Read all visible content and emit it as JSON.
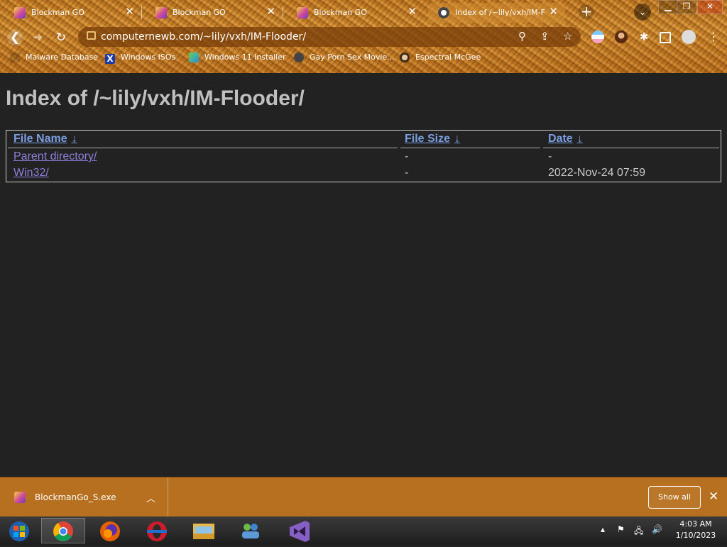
{
  "browser": {
    "tabs": [
      {
        "title": "Blockman GO",
        "active": false
      },
      {
        "title": "Blockman GO",
        "active": false
      },
      {
        "title": "Blockman GO",
        "active": false
      },
      {
        "title": "Index of /~lily/vxh/IM-F",
        "active": true
      }
    ],
    "tab_close": "✕",
    "new_tab": "+",
    "tab_search_icon": "chevron-down-icon",
    "window_controls": {
      "minimize": "▁",
      "restore": "❐",
      "close": "✕"
    },
    "address": "computernewb.com/~lily/vxh/IM-Flooder/",
    "nav": {
      "back": "❮",
      "forward": "➜",
      "reload": "↻"
    }
  },
  "bookmarks": [
    {
      "label": "Malware Database",
      "icon": "folder-icon"
    },
    {
      "label": "Windows ISOs",
      "icon": "x-logo-icon"
    },
    {
      "label": "Windows 11 Installer",
      "icon": "installer-icon"
    },
    {
      "label": "Gay Porn Sex Movie...",
      "icon": "site-icon"
    },
    {
      "label": "Espectral McGee",
      "icon": "face-icon"
    }
  ],
  "page": {
    "heading": "Index of /~lily/vxh/IM-Flooder/",
    "columns": [
      {
        "label": "File Name",
        "sort": "↓"
      },
      {
        "label": "File Size",
        "sort": "↓"
      },
      {
        "label": "Date",
        "sort": "↓"
      }
    ],
    "rows": [
      {
        "name": "Parent directory/",
        "size": "-",
        "date": "-"
      },
      {
        "name": "Win32/",
        "size": "-",
        "date": "2022-Nov-24 07:59"
      }
    ]
  },
  "downloads": {
    "file": "BlockmanGo_S.exe",
    "chevron": "︿",
    "show_all": "Show all",
    "close": "✕"
  },
  "taskbar": {
    "apps": [
      "start-orb",
      "chrome",
      "firefox",
      "opera",
      "file-explorer",
      "windows-live",
      "visual-studio"
    ],
    "time": "4:03 AM",
    "date": "1/10/2023"
  },
  "colors": {
    "chrome_bg": "#c47a22",
    "page_bg": "#222222",
    "heading": "#c0c0c0",
    "header_link": "#7a9ee0",
    "visited_link": "#8f7fd9",
    "download_bar": "#b7701f"
  }
}
